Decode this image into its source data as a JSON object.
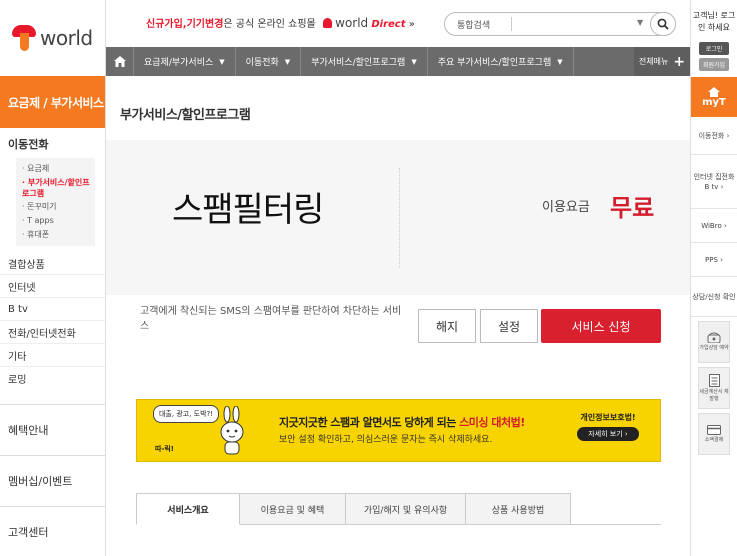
{
  "logo": {
    "word": "world"
  },
  "leftnav": {
    "active": "요금제 / 부가서비스",
    "sub_head": "이동전화",
    "sub_items": [
      {
        "label": "요금제",
        "on": false
      },
      {
        "label": "부가서비스/할인프로그램",
        "on": true
      },
      {
        "label": "돈꾸미기",
        "on": false
      },
      {
        "label": "T apps",
        "on": false
      },
      {
        "label": "휴대폰",
        "on": false
      }
    ],
    "items": [
      "결합상품",
      "인터넷",
      "B tv",
      "전화/인터넷전화",
      "기타",
      "로밍"
    ],
    "big_items": [
      "혜택안내",
      "멤버십/이벤트",
      "고객센터"
    ]
  },
  "header": {
    "promo_red": "신규가입,기기변경",
    "promo_text": "은 공식 온라인 쇼핑몰",
    "promo_brand": "world",
    "promo_direct": "Direct",
    "promo_arrow": "»",
    "search_type": "통합검색"
  },
  "crumbs": [
    "요금제/부가서비스",
    "이동전화",
    "부가서비스/할인프로그램",
    "주요 부가서비스/할인프로그램"
  ],
  "crumb_all": "전체메뉴",
  "page_title": "부가서비스/할인프로그램",
  "hero": {
    "name": "스팸필터링",
    "fee_label": "이용요금",
    "fee_value": "무료"
  },
  "desc": "고객에게 착신되는 SMS의 스팸여부를 판단하여 차단하는 서비스",
  "buttons": {
    "cancel": "해지",
    "setting": "설정",
    "apply": "서비스 신청"
  },
  "banner": {
    "speech": "대출, 광고, 도박?!",
    "ttik": "따-릭!",
    "line1_a": "지긋지긋한 스팸과 알면서도 당하게 되는 ",
    "line1_b": "스미싱 대처법!",
    "line2": "보안 설정 확인하고, 의심스러운 문자는 즉시 삭제하세요.",
    "privacy": "개인정보보호법!",
    "more": "자세히 보기 ›"
  },
  "tabs": [
    "서비스개요",
    "이용요금 및 혜택",
    "가입/해지 및 유의사항",
    "상품 사용방법"
  ],
  "rightnav": {
    "greet": "고객님! 로그인 하세요",
    "login": "로그인",
    "join": "회원가입",
    "myt": "myT",
    "items": [
      "이동전화 ›",
      "인터넷 집전화 B tv ›",
      "WiBro ›",
      "PPS ›",
      "상담/신청 확인"
    ],
    "squares": [
      "가입상담 예약",
      "세금계산서 재발행",
      "소액결제"
    ]
  },
  "colors": {
    "brand_orange": "#f47920",
    "brand_red": "#e8192c",
    "apply_red": "#d8202f"
  }
}
